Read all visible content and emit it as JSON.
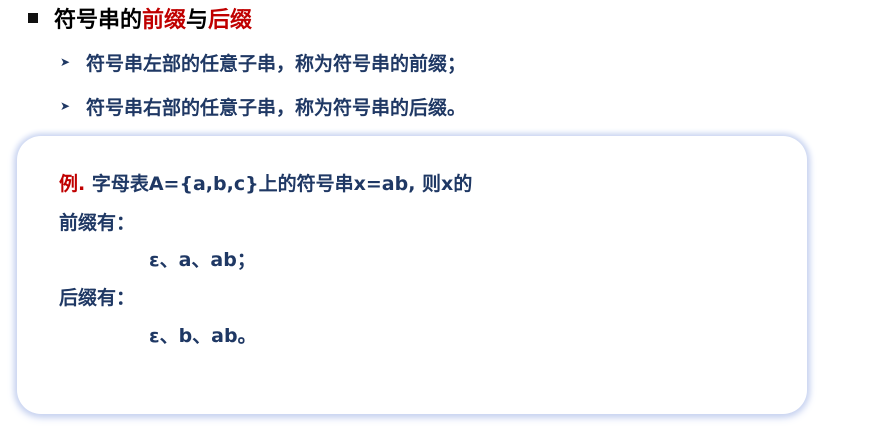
{
  "title": {
    "part1": "符号串的",
    "part2": "前缀",
    "part3": "与",
    "part4": "后缀",
    "accent_color": "#c00000"
  },
  "bullets": [
    "符号串左部的任意子串，称为符号串的前缀；",
    "符号串右部的任意子串，称为符号串的后缀。"
  ],
  "example": {
    "prefix": "例.",
    "statement": " 字母表A={a,b,c}上的符号串x=ab, 则x的",
    "prefix_label": "前缀有：",
    "prefix_values": "ε、a、ab；",
    "suffix_label": "后缀有：",
    "suffix_values": "ε、b、ab。"
  },
  "colors": {
    "text_navy": "#1f3864",
    "accent_red": "#c00000",
    "card_shadow": "#c9d4f0"
  },
  "icons": {
    "title_bullet": "square-bullet-icon",
    "sub_bullet": "arrowhead-bullet-icon"
  }
}
